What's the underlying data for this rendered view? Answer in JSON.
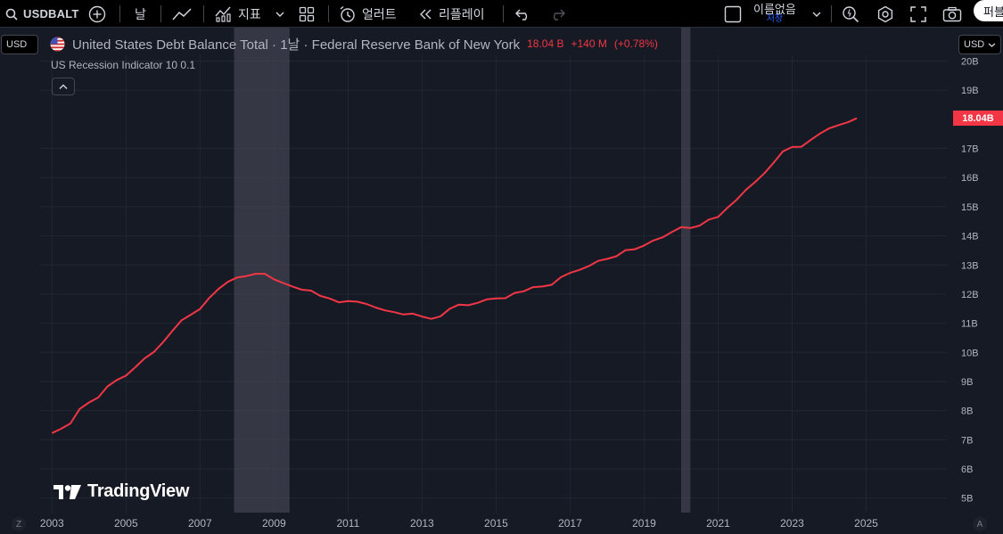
{
  "toolbar": {
    "symbol": "USDBALT",
    "interval": "날",
    "indicators_label": "지표",
    "alerts_label": "얼러트",
    "replay_label": "리플레이",
    "account_name": "이름없음",
    "account_sub": "저장",
    "publish_label": "퍼블"
  },
  "currency": {
    "left": "USD",
    "right": "USD"
  },
  "legend": {
    "title": "United States Debt Balance Total · 1날 · Federal Reserve Bank of New York",
    "last_value": "18.04 B",
    "change": "+140 M",
    "change_pct": "(+0.78%)",
    "indicator": "US Recession Indicator 10 0.1"
  },
  "price_label": "18.04B",
  "logo_text": "TradingView",
  "corner": {
    "left": "Z",
    "right": "A"
  },
  "colors": {
    "background": "#161a25",
    "line": "#f23645",
    "recession_band": "#434651",
    "grid": "#222633",
    "axis_text": "#b2b5be"
  },
  "chart_data": {
    "type": "line",
    "title": "United States Debt Balance Total",
    "xlabel": "",
    "ylabel": "",
    "x_ticks": [
      "2003",
      "2005",
      "2007",
      "2009",
      "2011",
      "2013",
      "2015",
      "2017",
      "2019",
      "2021",
      "2023",
      "2025"
    ],
    "y_ticks": [
      "5B",
      "6B",
      "7B",
      "8B",
      "9B",
      "10B",
      "11B",
      "12B",
      "13B",
      "14B",
      "15B",
      "16B",
      "17B",
      "19B",
      "20B"
    ],
    "xlim": [
      2002.68,
      2027.18
    ],
    "ylim": [
      4.5,
      20.2
    ],
    "grid": true,
    "recession_periods": [
      [
        2007.92,
        2009.42
      ],
      [
        2020.0,
        2020.25
      ]
    ],
    "series": [
      {
        "x": [
          2003.0,
          2003.25,
          2003.5,
          2003.75,
          2004.0,
          2004.25,
          2004.5,
          2004.75,
          2005.0,
          2005.25,
          2005.5,
          2005.75,
          2006.0,
          2006.25,
          2006.5,
          2006.75,
          2007.0,
          2007.25,
          2007.5,
          2007.75,
          2008.0,
          2008.25,
          2008.5,
          2008.75,
          2009.0,
          2009.25,
          2009.5,
          2009.75,
          2010.0,
          2010.25,
          2010.5,
          2010.75,
          2011.0,
          2011.25,
          2011.5,
          2011.75,
          2012.0,
          2012.25,
          2012.5,
          2012.75,
          2013.0,
          2013.25,
          2013.5,
          2013.75,
          2014.0,
          2014.25,
          2014.5,
          2014.75,
          2015.0,
          2015.25,
          2015.5,
          2015.75,
          2016.0,
          2016.25,
          2016.5,
          2016.75,
          2017.0,
          2017.25,
          2017.5,
          2017.75,
          2018.0,
          2018.25,
          2018.5,
          2018.75,
          2019.0,
          2019.25,
          2019.5,
          2019.75,
          2020.0,
          2020.25,
          2020.5,
          2020.75,
          2021.0,
          2021.25,
          2021.5,
          2021.75,
          2022.0,
          2022.25,
          2022.5,
          2022.75,
          2023.0,
          2023.25,
          2023.5,
          2023.75,
          2024.0,
          2024.25,
          2024.5,
          2024.75
        ],
        "values": [
          7.23,
          7.38,
          7.56,
          8.06,
          8.28,
          8.45,
          8.83,
          9.05,
          9.2,
          9.49,
          9.79,
          10.01,
          10.35,
          10.73,
          11.1,
          11.29,
          11.49,
          11.87,
          12.18,
          12.42,
          12.57,
          12.62,
          12.7,
          12.7,
          12.51,
          12.38,
          12.26,
          12.15,
          12.12,
          11.94,
          11.85,
          11.72,
          11.76,
          11.74,
          11.66,
          11.54,
          11.44,
          11.38,
          11.3,
          11.33,
          11.23,
          11.15,
          11.24,
          11.5,
          11.64,
          11.62,
          11.7,
          11.82,
          11.85,
          11.86,
          12.04,
          12.1,
          12.24,
          12.26,
          12.32,
          12.58,
          12.73,
          12.83,
          12.96,
          13.14,
          13.21,
          13.3,
          13.51,
          13.54,
          13.67,
          13.84,
          13.95,
          14.13,
          14.3,
          14.27,
          14.35,
          14.56,
          14.65,
          14.96,
          15.24,
          15.58,
          15.85,
          16.15,
          16.51,
          16.9,
          17.05,
          17.06,
          17.29,
          17.51,
          17.69,
          17.8,
          17.9,
          18.04
        ]
      }
    ]
  }
}
